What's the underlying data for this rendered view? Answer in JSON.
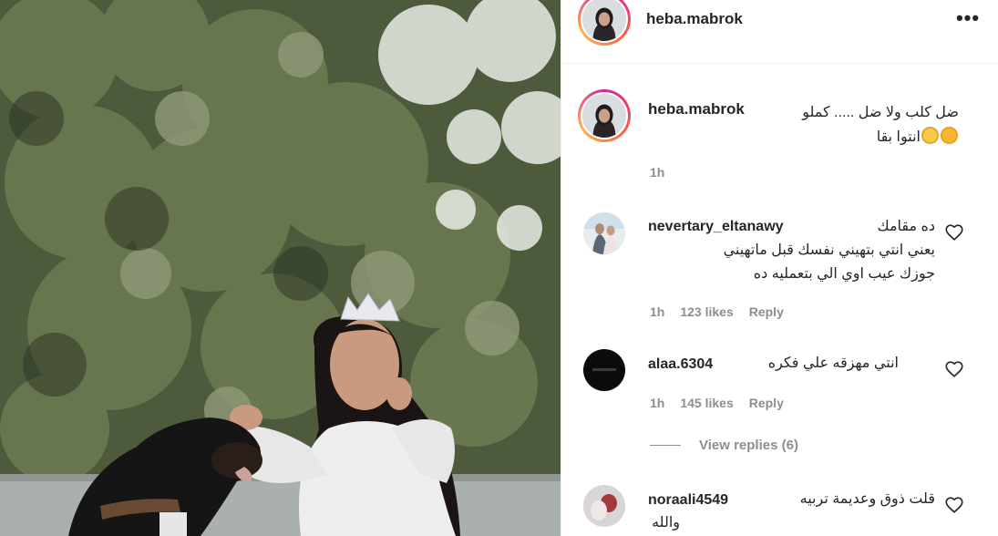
{
  "post": {
    "username": "heba.mabrok",
    "more_icon": "more-horizontal-icon",
    "caption": {
      "line1": "ضل كلب ولا ضل ..... كملو",
      "line2": "انتوا بقا",
      "time": "1h"
    }
  },
  "comments": [
    {
      "username": "nevertary_eltanawy",
      "lines": [
        "ده مقامك",
        "يعني انتي بتهيني نفسك قبل ماتهيني",
        "جوزك عيب اوي الي بتعمليه ده"
      ],
      "time": "1h",
      "likes": "123 likes",
      "reply": "Reply"
    },
    {
      "username": "alaa.6304",
      "lines": [
        "انتي مهزقه علي فكره"
      ],
      "time": "1h",
      "likes": "145 likes",
      "reply": "Reply",
      "view_replies": "View replies (6)"
    },
    {
      "username": "noraali4549",
      "lines": [
        "قلت ذوق وعديمة تربيه",
        "والله"
      ]
    }
  ],
  "icons": [
    "heart-icon",
    "more-horizontal-icon",
    "avatar"
  ],
  "colors": {
    "muted": "#8e8e8e",
    "text": "#262626",
    "divider": "#efefef"
  }
}
